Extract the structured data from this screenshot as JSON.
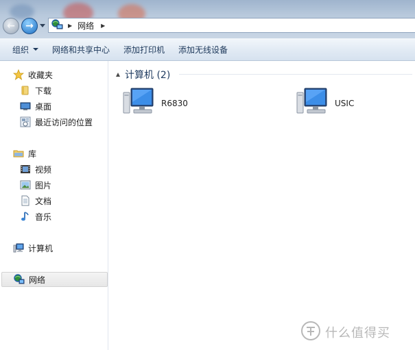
{
  "address_bar": {
    "location_icon": "network-icon",
    "path": [
      "网络"
    ]
  },
  "command_bar": {
    "items": [
      "组织",
      "网络和共享中心",
      "添加打印机",
      "添加无线设备"
    ]
  },
  "sidebar": {
    "favorites": {
      "label": "收藏夹",
      "icon": "star-icon",
      "items": [
        {
          "label": "下载",
          "icon": "folder-icon"
        },
        {
          "label": "桌面",
          "icon": "desktop-icon"
        },
        {
          "label": "最近访问的位置",
          "icon": "recent-places-icon"
        }
      ]
    },
    "libraries": {
      "label": "库",
      "icon": "library-icon",
      "items": [
        {
          "label": "视频",
          "icon": "video-icon"
        },
        {
          "label": "图片",
          "icon": "picture-icon"
        },
        {
          "label": "文档",
          "icon": "document-icon"
        },
        {
          "label": "音乐",
          "icon": "music-icon"
        }
      ]
    },
    "computer": {
      "label": "计算机",
      "icon": "computer-icon"
    },
    "network": {
      "label": "网络",
      "icon": "network-icon",
      "selected": true
    }
  },
  "content": {
    "group_title": "计算机 (2)",
    "computers": [
      {
        "name": "R6830",
        "icon": "computer-icon"
      },
      {
        "name": "USIC",
        "icon": "computer-icon"
      }
    ]
  },
  "watermark": {
    "text": "什么值得买"
  },
  "colors": {
    "command_text": "#1e395b",
    "group_title": "#1e3a5f",
    "selection_bg": "#e7e7e7"
  }
}
